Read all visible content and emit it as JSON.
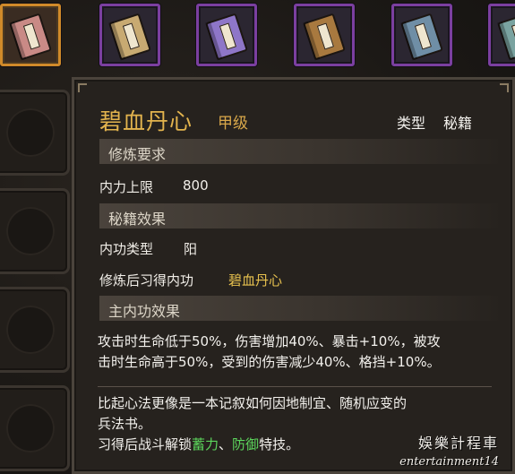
{
  "inventory": {
    "slots": [
      {
        "icon": "pink-manual-book-icon",
        "color": "#c98a86",
        "selected": true
      },
      {
        "icon": "tan-manual-book-icon",
        "color": "#c8aa72",
        "selected": false
      },
      {
        "icon": "purple-manual-book-icon",
        "color": "#8e76c8",
        "selected": false
      },
      {
        "icon": "brown-manual-book-icon",
        "color": "#a8793f",
        "selected": false
      },
      {
        "icon": "blue-manual-book-icon",
        "color": "#6f8ea6",
        "selected": false
      },
      {
        "icon": "teal-manual-book-icon",
        "color": "#7aa3a0",
        "selected": false
      }
    ]
  },
  "tooltip": {
    "title": "碧血丹心",
    "grade": "甲级",
    "type_label": "类型",
    "type_value": "秘籍",
    "sections": {
      "requirement": "修炼要求",
      "manual_effect": "秘籍效果",
      "main_effect": "主内功效果"
    },
    "requirement": {
      "label": "内力上限",
      "value": "800"
    },
    "manual_effect": {
      "kungfu_type_label": "内功类型",
      "kungfu_type_value": "阳",
      "learn_label": "修炼后习得内功",
      "learn_value": "碧血丹心"
    },
    "main_effect": {
      "line1": "攻击时生命低于50%，伤害增加40%、暴击+10%，被攻",
      "line2": "击时生命高于50%，受到的伤害减少40%、格挡+10%。"
    },
    "description": {
      "line1": "比起心法更像是一本记叙如何因地制宜、随机应变的",
      "line2": "兵法书。",
      "line3_prefix": "习得后战斗解锁",
      "skill1": "蓄力",
      "separator": "、",
      "skill2": "防御",
      "line3_suffix": "特技。"
    }
  },
  "watermark": {
    "cn": "娛樂計程車",
    "en": "entertainment14"
  },
  "colors": {
    "title_gold": "#e3b44e",
    "skill_green": "#5cd65c",
    "selected_border": "#d08a2a",
    "slot_border": "#7b3fa0"
  }
}
